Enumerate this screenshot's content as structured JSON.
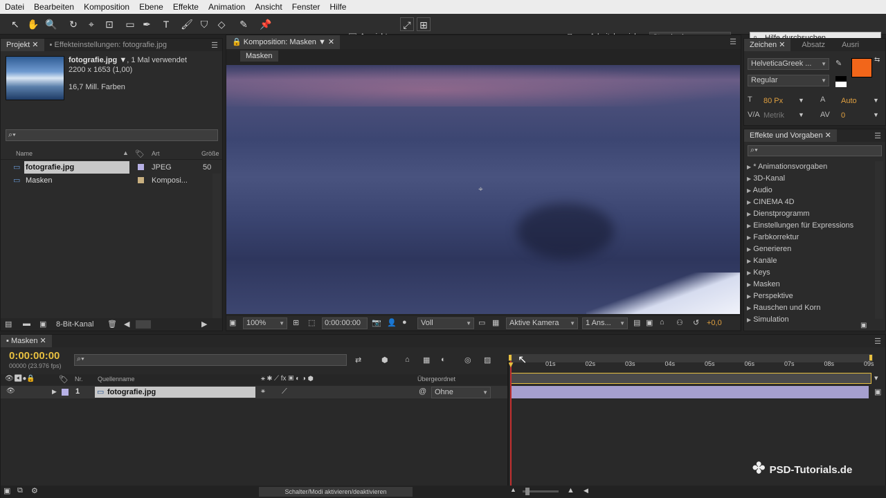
{
  "menu": [
    "Datei",
    "Bearbeiten",
    "Komposition",
    "Ebene",
    "Effekte",
    "Animation",
    "Ansicht",
    "Fenster",
    "Hilfe"
  ],
  "toolbar": {
    "align_label": "Ausrichten",
    "workspace_label": "Arbeitsbereich:",
    "workspace_value": "Standard",
    "help_search_placeholder": "Hilfe durchsuchen"
  },
  "project": {
    "tabs": [
      "Projekt",
      "Effekteinstellungen: fotografie.jpg"
    ],
    "file_name": "fotografie.jpg",
    "usage": ", 1 Mal verwendet",
    "dimensions": "2200 x 1653 (1,00)",
    "colors": "16,7 Mill. Farben",
    "col_name": "Name",
    "col_type": "Art",
    "col_size": "Größe",
    "items": [
      {
        "name": "fotografie.jpg",
        "type": "JPEG",
        "size": "50",
        "color": "#b7b1e6"
      },
      {
        "name": "Masken",
        "type": "Komposi...",
        "size": "",
        "color": "#c9b080"
      }
    ],
    "bit_depth": "8-Bit-Kanal"
  },
  "composition": {
    "tab": "Komposition: Masken",
    "breadcrumb": "Masken",
    "zoom": "100%",
    "timecode": "0:00:00:00",
    "resolution": "Voll",
    "camera": "Aktive Kamera",
    "views": "1 Ans...",
    "exposure": "+0,0"
  },
  "character": {
    "tabs": [
      "Zeichen",
      "Absatz",
      "Ausri"
    ],
    "font": "HelveticaGreek ...",
    "style": "Regular",
    "size": "80 Px",
    "leading": "Auto",
    "kerning": "Metrik",
    "tracking": "0",
    "fill_color": "#f2661a"
  },
  "effects": {
    "tab": "Effekte und Vorgaben",
    "items": [
      "* Animationsvorgaben",
      "3D-Kanal",
      "Audio",
      "CINEMA 4D",
      "Dienstprogramm",
      "Einstellungen für Expressions",
      "Farbkorrektur",
      "Generieren",
      "Kanäle",
      "Keys",
      "Masken",
      "Perspektive",
      "Rauschen und Korn",
      "Simulation"
    ]
  },
  "timeline": {
    "tab": "Masken",
    "timecode": "0:00:00:00",
    "fps": "00000 (23.976 fps)",
    "col_nr": "Nr.",
    "col_source": "Quellenname",
    "col_parent": "Übergeordnet",
    "layer_nr": "1",
    "layer_name": "fotografie.jpg",
    "parent_value": "Ohne",
    "ruler": [
      "01s",
      "02s",
      "03s",
      "04s",
      "05s",
      "06s",
      "07s",
      "08s",
      "09s"
    ],
    "toggle_label": "Schalter/Modi aktivieren/deaktivieren"
  },
  "watermark": "PSD-Tutorials.de"
}
